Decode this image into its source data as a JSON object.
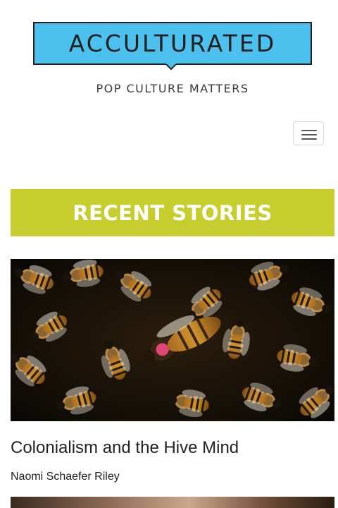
{
  "site": {
    "logo_text": "ACCULTURATED",
    "tagline": "POP CULTURE MATTERS",
    "brand_color": "#4dc1ee",
    "accent_color": "#c7cd2c"
  },
  "nav": {
    "menu_icon": "hamburger-menu-icon"
  },
  "section": {
    "title": "RECENT STORIES"
  },
  "stories": [
    {
      "image": "honeybee-colony-photo",
      "title": "Colonialism and the Hive Mind",
      "author": "Naomi Schaefer Riley"
    },
    {
      "image": "partial-next-story-photo"
    }
  ]
}
